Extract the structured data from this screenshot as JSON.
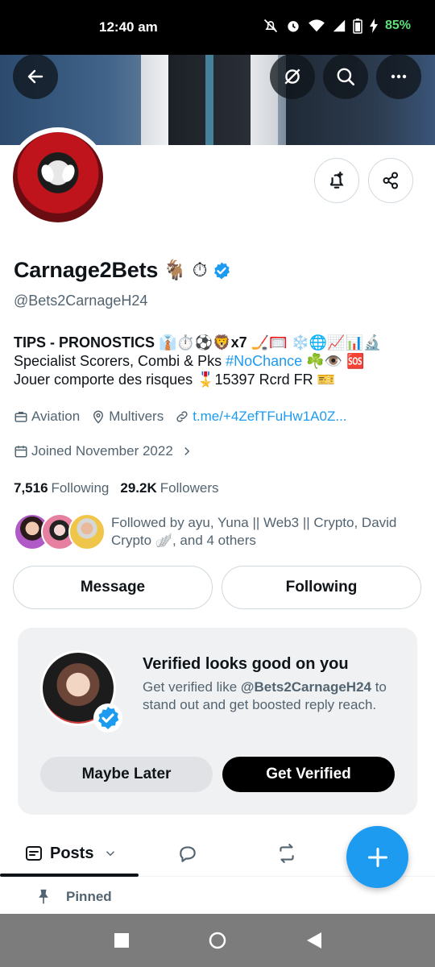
{
  "status_bar": {
    "time": "12:40 am",
    "battery": "85%"
  },
  "header": {
    "icons": [
      "arrow-left-icon",
      "grok-icon",
      "search-icon",
      "more-icon"
    ]
  },
  "profile": {
    "display_name": "Carnage2Bets",
    "name_emoji": "🐐 ⏱",
    "handle": "@Bets2CarnageH24",
    "bio": {
      "line1": "TIPS - PRONOSTICS 👔⏱️⚽🦁x7 🏒🥅 ❄️🌐📈📊🔬",
      "line2_prefix": "Specialist Scorers, Combi & Pks ",
      "line2_hashtag": "#NoChance",
      "line2_suffix": " ☘️👁️ 🆘",
      "line3": "Jouer comporte des risques 🎖️15397 Rcrd FR 🎫"
    },
    "category": "Aviation",
    "location": "Multivers",
    "link": "t.me/+4ZefTFuHw1A0Z...",
    "joined": "Joined November 2022",
    "following_count": "7,516",
    "following_label": "Following",
    "followers_count": "29.2K",
    "followers_label": "Followers",
    "followed_by": "Followed by ayu, Yuna || Web3 || Crypto, David Crypto 🪽, and 4 others"
  },
  "actions": {
    "message": "Message",
    "following": "Following"
  },
  "promo": {
    "title": "Verified looks good on you",
    "text_prefix": "Get verified like ",
    "text_handle": "@Bets2CarnageH24",
    "text_suffix": " to stand out and get boosted reply reach.",
    "maybe_later": "Maybe Later",
    "get_verified": "Get Verified"
  },
  "tabs": {
    "posts": "Posts"
  },
  "pinned": {
    "label": "Pinned"
  },
  "colors": {
    "accent": "#1d9bf0",
    "text": "#0f1419",
    "muted": "#536471",
    "battery": "#5ee07a"
  }
}
